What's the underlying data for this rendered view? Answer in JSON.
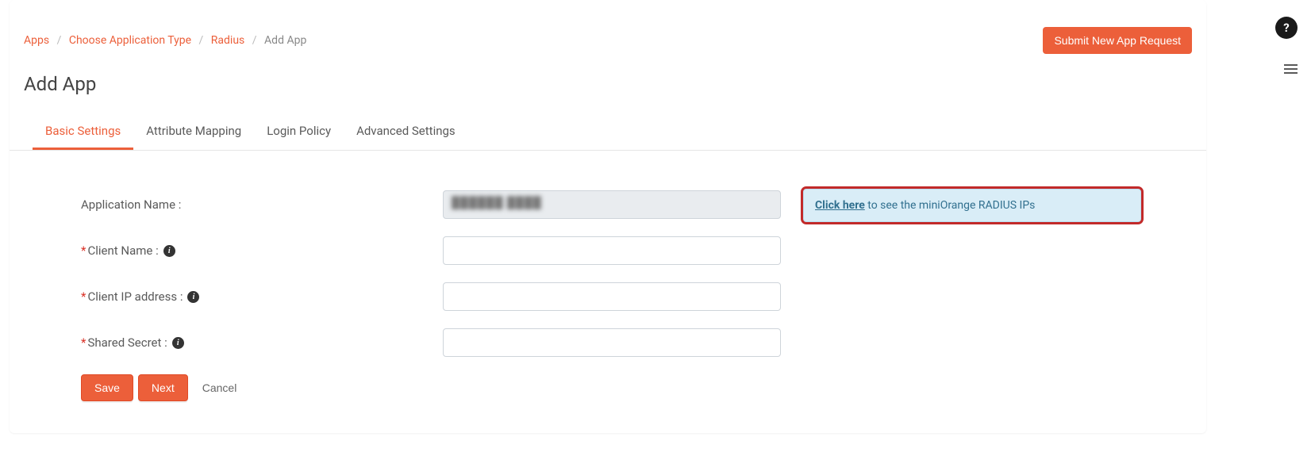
{
  "help_icon_label": "?",
  "breadcrumb": {
    "items": [
      {
        "label": "Apps"
      },
      {
        "label": "Choose Application Type"
      },
      {
        "label": "Radius"
      }
    ],
    "current": "Add App"
  },
  "submit_request_label": "Submit New App Request",
  "page_title": "Add App",
  "tabs": [
    {
      "label": "Basic Settings",
      "active": true
    },
    {
      "label": "Attribute Mapping",
      "active": false
    },
    {
      "label": "Login Policy",
      "active": false
    },
    {
      "label": "Advanced Settings",
      "active": false
    }
  ],
  "form": {
    "application_name": {
      "label": "Application Name :",
      "value_masked": "██████  ████"
    },
    "client_name": {
      "label": "Client Name :",
      "value": ""
    },
    "client_ip": {
      "label": "Client IP address :",
      "value": ""
    },
    "shared_secret": {
      "label": "Shared Secret :",
      "value": ""
    }
  },
  "hint": {
    "link_text": "Click here",
    "rest_text": " to see the miniOrange RADIUS IPs"
  },
  "actions": {
    "save": "Save",
    "next": "Next",
    "cancel": "Cancel"
  }
}
